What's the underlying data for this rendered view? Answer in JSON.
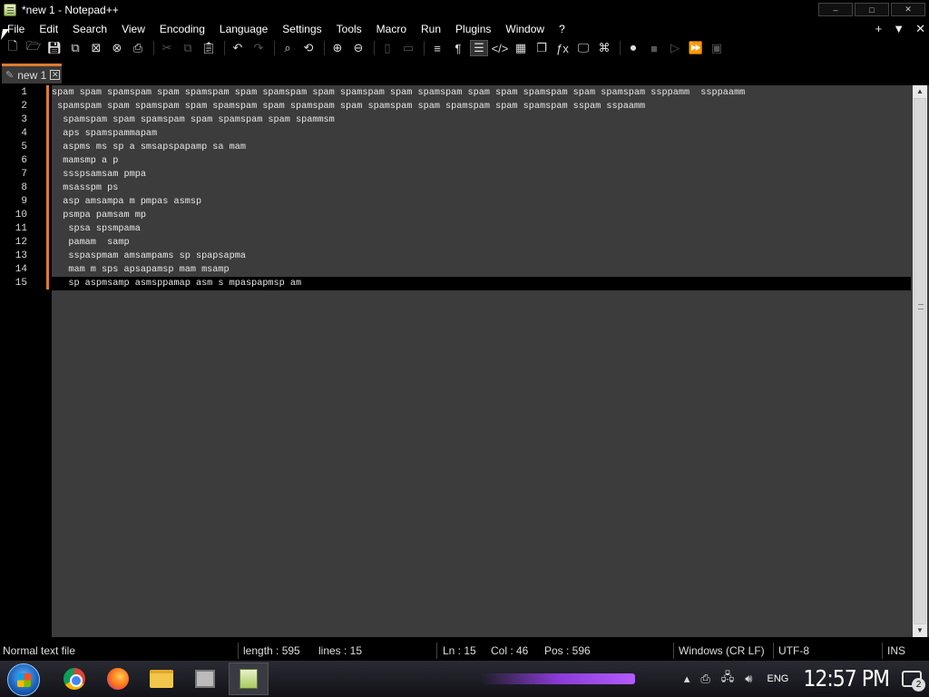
{
  "window": {
    "title": "*new 1 - Notepad++",
    "controls": [
      "–",
      "□",
      "✕"
    ]
  },
  "menu": {
    "items": [
      "File",
      "Edit",
      "Search",
      "View",
      "Encoding",
      "Language",
      "Settings",
      "Tools",
      "Macro",
      "Run",
      "Plugins",
      "Window",
      "?"
    ],
    "right": [
      "+",
      "▼",
      "✕"
    ]
  },
  "toolbar": {
    "icons": [
      "new-file-icon",
      "open-file-icon",
      "save-icon",
      "save-all-icon",
      "close-icon",
      "close-all-icon",
      "print-icon",
      "cut-icon",
      "copy-icon",
      "paste-icon",
      "undo-icon",
      "redo-icon",
      "find-icon",
      "replace-icon",
      "zoom-in-icon",
      "zoom-out-icon",
      "sync-vertical-icon",
      "sync-horizontal-icon",
      "word-wrap-icon",
      "show-all-chars-icon",
      "indent-guide-icon",
      "xml-tag-icon",
      "document-map-icon",
      "function-list-icon",
      "fx-icon",
      "monitor-icon",
      "screenshot-icon",
      "record-macro-icon",
      "stop-record-icon",
      "play-macro-icon",
      "run-multiple-icon",
      "save-macro-icon"
    ]
  },
  "tab": {
    "label": "new 1",
    "close": "✕"
  },
  "editor": {
    "line_numbers": [
      "1",
      "2",
      "3",
      "4",
      "5",
      "6",
      "7",
      "8",
      "9",
      "10",
      "11",
      "12",
      "13",
      "14",
      "15"
    ],
    "lines": [
      "spam spam spamspam spam spamspam spam spamspam spam spamspam spam spamspam spam spam spamspam spam spamspam ssppamm  ssppaamm",
      " spamspam spam spamspam spam spamspam spam spamspam spam spamspam spam spamspam spam spamspam sspam sspaamm",
      "  spamspam spam spamspam spam spamspam spam spammsm",
      "  aps spamspammapam",
      "  aspms ms sp a smsapspapamp sa mam",
      "  mamsmp a p",
      "  ssspsamsam pmpa",
      "  msasspm ps",
      "  asp amsampa m pmpas asmsp",
      "  psmpa pamsam mp",
      "   spsa spsmpama",
      "   pamam  samp",
      "   sspaspmam amsampams sp spapsapma",
      "   mam m sps apsapamsp mam msamp",
      "   sp aspmsamp asmsppamap asm s mpaspapmsp am"
    ],
    "current_line": 15
  },
  "statusbar": {
    "file_type": "Normal text file",
    "length": "length : 595",
    "lines": "lines : 15",
    "ln": "Ln : 15",
    "col": "Col : 46",
    "pos": "Pos : 596",
    "eol": "Windows (CR LF)",
    "encoding": "UTF-8",
    "mode": "INS"
  },
  "taskbar": {
    "apps": [
      "start-orb",
      "chrome-icon",
      "firefox-icon",
      "file-explorer-icon",
      "package-icon",
      "notepadpp-icon"
    ],
    "lang": "ENG",
    "clock": "12:57 PM",
    "notifications": "2"
  }
}
